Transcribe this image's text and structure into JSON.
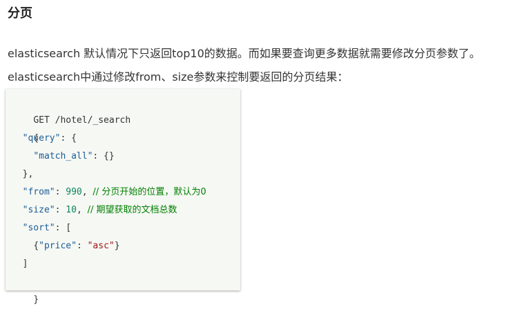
{
  "heading": "分页",
  "paragraphs": [
    "elasticsearch 默认情况下只返回top10的数据。而如果要查询更多数据就需要修改分页参数了。",
    "elasticsearch中通过修改from、size参数来控制要返回的分页结果："
  ],
  "code": {
    "request_line": "GET /hotel/_search",
    "open_brace": "{",
    "query_key": "\"query\"",
    "query_colon": ": {",
    "match_all_key": "\"match_all\"",
    "match_all_val": ": {}",
    "query_close": "},",
    "from_key": "\"from\"",
    "from_colon": ": ",
    "from_val": "990",
    "from_comma": ", ",
    "from_comment": "// 分页开始的位置，默认为0",
    "size_key": "\"size\"",
    "size_colon": ": ",
    "size_val": "10",
    "size_comma": ", ",
    "size_comment": "// 期望获取的文档总数",
    "sort_key": "\"sort\"",
    "sort_colon": ": [",
    "sort_item_open": "{",
    "price_key": "\"price\"",
    "price_colon": ": ",
    "price_val": "\"asc\"",
    "sort_item_close": "}",
    "sort_close": "]",
    "close_brace": "}"
  }
}
